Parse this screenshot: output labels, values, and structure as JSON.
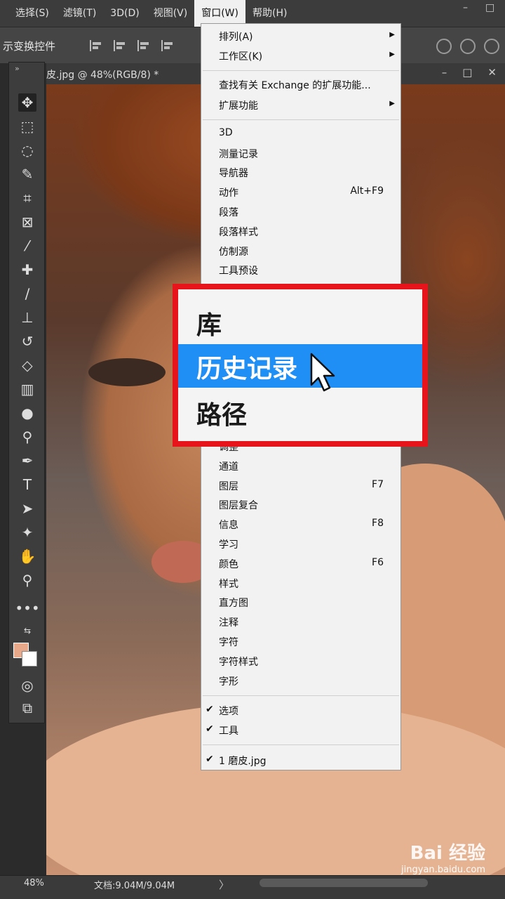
{
  "menubar": {
    "items": [
      "选择(S)",
      "滤镜(T)",
      "3D(D)",
      "视图(V)",
      "窗口(W)",
      "帮助(H)"
    ],
    "active_index": 4
  },
  "optionsbar": {
    "label": "示变换控件"
  },
  "document": {
    "tab_title": "皮.jpg @ 48%(RGB/8) *"
  },
  "window_menu": {
    "arrange": "排列(A)",
    "workspace": "工作区(K)",
    "find_exchange": "查找有关 Exchange 的扩展功能...",
    "extensions": "扩展功能",
    "panels": [
      {
        "label": "3D",
        "shortcut": ""
      },
      {
        "label": "测量记录",
        "shortcut": ""
      },
      {
        "label": "导航器",
        "shortcut": ""
      },
      {
        "label": "动作",
        "shortcut": "Alt+F9"
      },
      {
        "label": "段落",
        "shortcut": ""
      },
      {
        "label": "段落样式",
        "shortcut": ""
      },
      {
        "label": "仿制源",
        "shortcut": ""
      },
      {
        "label": "工具预设",
        "shortcut": ""
      }
    ],
    "partial_item": "调整",
    "panels2": [
      {
        "label": "通道",
        "shortcut": ""
      },
      {
        "label": "图层",
        "shortcut": "F7"
      },
      {
        "label": "图层复合",
        "shortcut": ""
      },
      {
        "label": "信息",
        "shortcut": "F8"
      },
      {
        "label": "学习",
        "shortcut": ""
      },
      {
        "label": "颜色",
        "shortcut": "F6"
      },
      {
        "label": "样式",
        "shortcut": ""
      },
      {
        "label": "直方图",
        "shortcut": ""
      },
      {
        "label": "注释",
        "shortcut": ""
      },
      {
        "label": "字符",
        "shortcut": ""
      },
      {
        "label": "字符样式",
        "shortcut": ""
      },
      {
        "label": "字形",
        "shortcut": ""
      }
    ],
    "checked": [
      {
        "label": "选项",
        "checked": true
      },
      {
        "label": "工具",
        "checked": true
      }
    ],
    "open_doc": {
      "label": "1 磨皮.jpg",
      "checked": true
    }
  },
  "zoom_callout": {
    "items": [
      "库",
      "历史记录",
      "路径"
    ],
    "highlighted_index": 1,
    "border_color": "#e8141c",
    "highlight_color": "#1f8ef5"
  },
  "statusbar": {
    "zoom": "48%",
    "doc_info": "文档:9.04M/9.04M",
    "nav_arrow": "〉"
  },
  "watermark": {
    "brand": "Bai 经验",
    "url": "jingyan.baidu.com"
  },
  "colors": {
    "foreground": "#e8a98a",
    "background": "#ffffff"
  }
}
